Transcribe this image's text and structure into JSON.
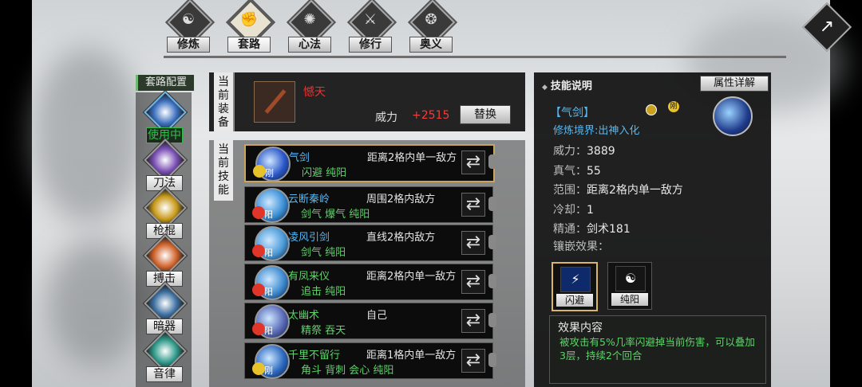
{
  "tabs": [
    {
      "label": "修炼",
      "glyph": "☯",
      "active": false
    },
    {
      "label": "套路",
      "glyph": "✊",
      "active": true
    },
    {
      "label": "心法",
      "glyph": "✺",
      "active": false
    },
    {
      "label": "修行",
      "glyph": "⚔",
      "active": false
    },
    {
      "label": "奥义",
      "glyph": "❂",
      "active": false
    }
  ],
  "close_glyph": "↗",
  "sidebar": {
    "title": "套路配置",
    "items": [
      {
        "label": "使用中",
        "active": true,
        "color": "#3b6fbf"
      },
      {
        "label": "刀法",
        "active": false,
        "color": "#7a4fb5"
      },
      {
        "label": "枪棍",
        "active": false,
        "color": "#c99a1a"
      },
      {
        "label": "搏击",
        "active": false,
        "color": "#d0622a"
      },
      {
        "label": "暗器",
        "active": false,
        "color": "#3d6fa0"
      },
      {
        "label": "音律",
        "active": false,
        "color": "#2f9a8a"
      }
    ]
  },
  "equip": {
    "label": "当前装备",
    "weapon_name": "憾天",
    "power_label": "威力",
    "power_value": "+2515",
    "replace_label": "替换"
  },
  "skills_label": "当前技能",
  "skills": [
    {
      "name": "气剑",
      "name_color": "#58b6ef",
      "range": "距离2格内单一敌方",
      "traits": "闪避  纯阳",
      "tag": "刚",
      "badge_color": "#e7c22a",
      "icon_color": "#2b57c9",
      "selected": true
    },
    {
      "name": "云断秦岭",
      "name_color": "#58b6ef",
      "range": "周围2格内敌方",
      "traits": "剑气  爆气  纯阳",
      "tag": "阳",
      "badge_color": "#e0362a",
      "icon_color": "#3a8fd6",
      "selected": false
    },
    {
      "name": "凌风引剑",
      "name_color": "#58b6ef",
      "range": "直线2格内敌方",
      "traits": "剑气  纯阳",
      "tag": "阳",
      "badge_color": "#e0362a",
      "icon_color": "#4a9bd8",
      "selected": false
    },
    {
      "name": "有凤来仪",
      "name_color": "#5ed36a",
      "range": "距离2格内单一敌方",
      "traits": "追击  纯阳",
      "tag": "阳",
      "badge_color": "#e0362a",
      "icon_color": "#3e8bd0",
      "selected": false
    },
    {
      "name": "太幽术",
      "name_color": "#5ed36a",
      "range": "自己",
      "traits": "精祭  吞天",
      "tag": "阳",
      "badge_color": "#e0362a",
      "icon_color": "#5a6bb8",
      "selected": false
    },
    {
      "name": "千里不留行",
      "name_color": "#5ed36a",
      "range": "距离1格内单一敌方",
      "traits": "角斗  背刺  会心  纯阳",
      "tag": "刚",
      "badge_color": "#e7c22a",
      "icon_color": "#2c6ac0",
      "selected": false
    }
  ],
  "detail": {
    "title": "技能说明",
    "attr_button": "属性详解",
    "skill_name": "【气剑】",
    "badge_tag": "刚",
    "realm": "修炼境界:出神入化",
    "stats": [
      {
        "k": "威力：",
        "v": "3889"
      },
      {
        "k": "真气：",
        "v": "55"
      },
      {
        "k": "范围：",
        "v": "距离2格内单一敌方"
      },
      {
        "k": "冷却：",
        "v": "1"
      },
      {
        "k": "精通：",
        "v": "剑术181"
      }
    ],
    "inlay_label": "镶嵌效果：",
    "gems": [
      {
        "label": "闪避",
        "glyph": "⚡",
        "selected": true
      },
      {
        "label": "纯阳",
        "glyph": "☯",
        "selected": false
      }
    ],
    "effect_title": "效果内容",
    "effect_text": "被攻击有5%几率闪避掉当前伤害，可以叠加3层，持续2个回合"
  }
}
